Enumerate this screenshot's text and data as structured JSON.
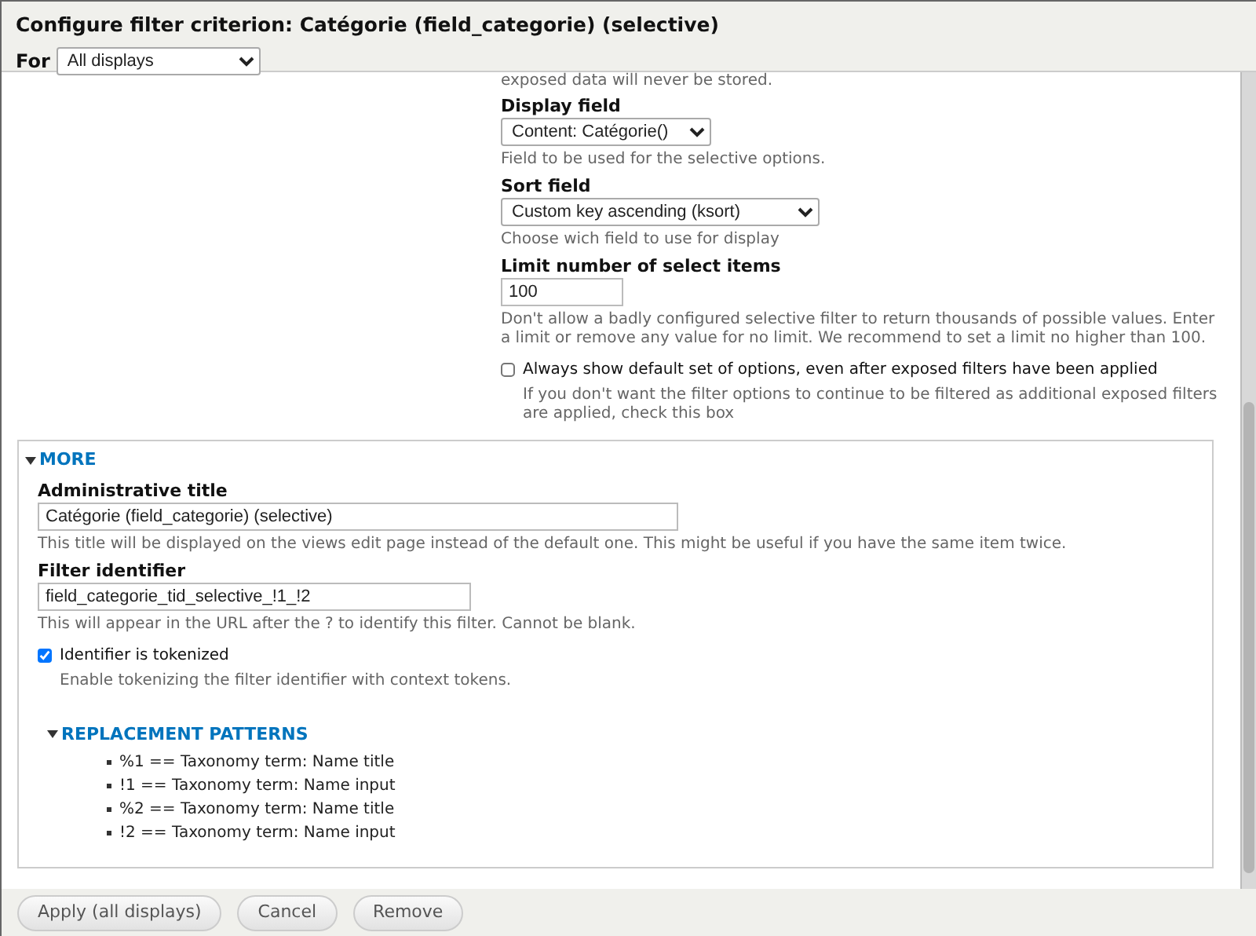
{
  "dialog": {
    "title": "Configure filter criterion: Catégorie (field_categorie) (selective)"
  },
  "for_select": {
    "label": "For",
    "value": "All displays"
  },
  "upper_fields": [
    {
      "kind": "note",
      "text": "exposed data will never be stored."
    },
    {
      "kind": "select",
      "label": "Display field",
      "value": "Content: Catégorie()",
      "description": "Field to be used for the selective options."
    },
    {
      "kind": "select",
      "label": "Sort field",
      "value": "Custom key ascending (ksort)",
      "description": "Choose wich field to use for display"
    },
    {
      "kind": "text",
      "label": "Limit number of select items",
      "value": "100",
      "description": "Don't allow a badly configured selective filter to return thousands of possible values. Enter a limit or remove any value for no limit. We recommend to set a limit no higher than 100."
    },
    {
      "kind": "checkbox",
      "label": "Always show default set of options, even after exposed filters have been applied",
      "checked": false,
      "description": "If you don't want the filter options to continue to be filtered as additional exposed filters are applied, check this box"
    }
  ],
  "more": {
    "label": "MORE",
    "expanded": true,
    "fields": [
      {
        "kind": "text",
        "label": "Administrative title",
        "value": "Catégorie (field_categorie) (selective)",
        "description": "This title will be displayed on the views edit page instead of the default one. This might be useful if you have the same item twice."
      },
      {
        "kind": "text",
        "label": "Filter identifier",
        "value": "field_categorie_tid_selective_!1_!2",
        "description": "This will appear in the URL after the ? to identify this filter. Cannot be blank."
      },
      {
        "kind": "checkbox",
        "label": "Identifier is tokenized",
        "checked": true,
        "description": "Enable tokenizing the filter identifier with context tokens."
      }
    ],
    "replacement_patterns": {
      "label": "REPLACEMENT PATTERNS",
      "expanded": true,
      "items": [
        "%1 == Taxonomy term: Name title",
        "!1 == Taxonomy term: Name input",
        "%2 == Taxonomy term: Name title",
        "!2 == Taxonomy term: Name input"
      ]
    }
  },
  "buttons": [
    "Apply (all displays)",
    "Cancel",
    "Remove"
  ]
}
